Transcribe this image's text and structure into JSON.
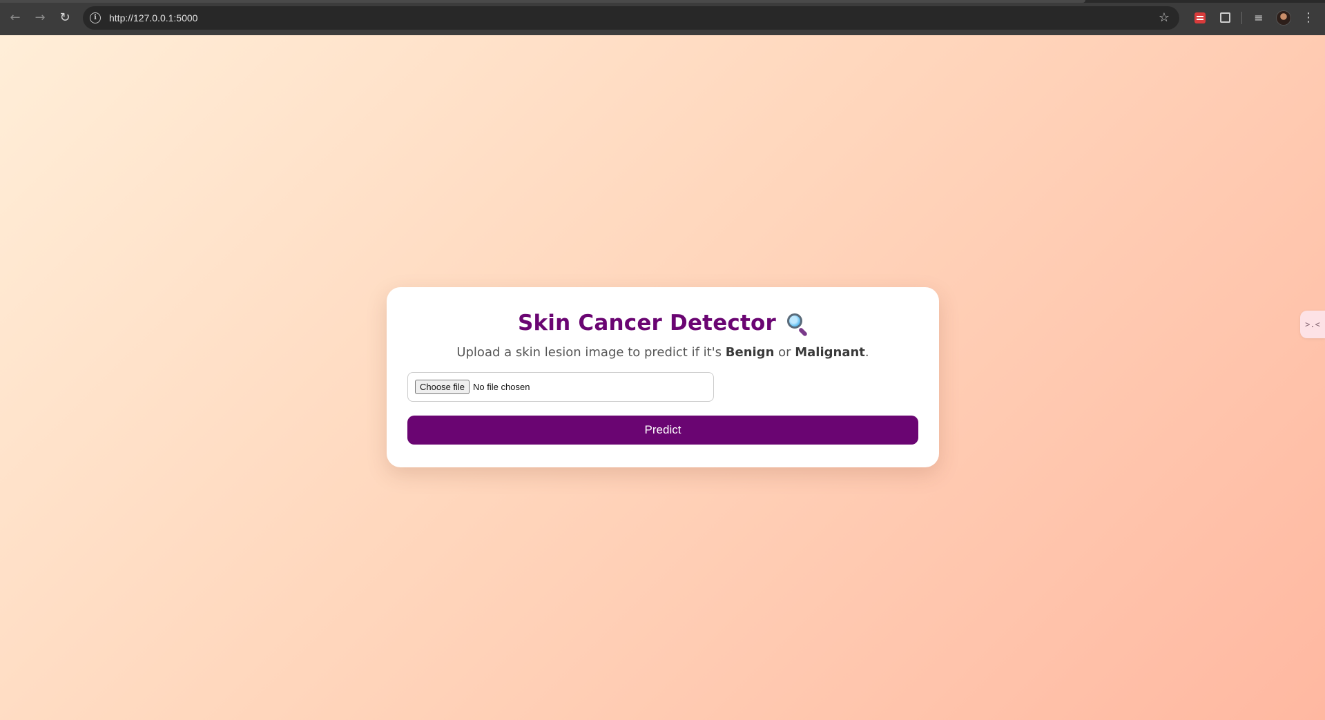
{
  "browser": {
    "url": "http://127.0.0.1:5000",
    "icons": {
      "back": "arrow-left-icon",
      "forward": "arrow-right-icon",
      "reload": "reload-icon",
      "site_info": "info-icon",
      "bookmark": "star-icon",
      "extension": "extension-icon",
      "extensions_menu": "puzzle-icon",
      "reading_list": "reading-list-icon",
      "profile": "avatar",
      "menu": "kebab-menu-icon"
    }
  },
  "page": {
    "title": "Skin Cancer Detector",
    "title_icon": "magnifying-glass-icon",
    "subtitle_prefix": "Upload a skin lesion image to predict if it's ",
    "subtitle_benign": "Benign",
    "subtitle_or": " or ",
    "subtitle_malignant": "Malignant",
    "subtitle_suffix": ".",
    "file_button_label": "Choose file",
    "file_status": "No file chosen",
    "predict_label": "Predict",
    "side_widget_glyph": ">.<"
  },
  "colors": {
    "accent": "#6a0572",
    "gradient_start": "#ffeed8",
    "gradient_end": "#ffb8a1"
  }
}
